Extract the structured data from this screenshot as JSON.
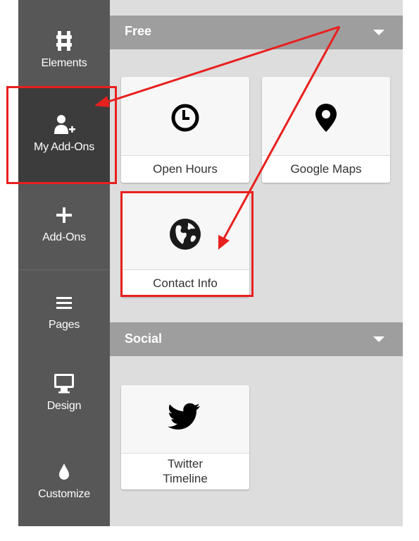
{
  "colors": {
    "sidebar_bg": "#575757",
    "sidebar_active_bg": "#3c3c3c",
    "panel_bg": "#dddddd",
    "section_header_bg": "#9e9e9e",
    "card_bg": "#f7f7f7",
    "annotation_red": "#e8201e"
  },
  "sidebar": {
    "items": [
      {
        "label": "Elements",
        "icon": "elements-icon",
        "active": false
      },
      {
        "label": "My Add-Ons",
        "icon": "user-plus-icon",
        "active": true
      },
      {
        "label": "Add-Ons",
        "icon": "plus-icon",
        "active": false
      },
      {
        "label": "Pages",
        "icon": "menu-icon",
        "active": false
      },
      {
        "label": "Design",
        "icon": "monitor-icon",
        "active": false
      },
      {
        "label": "Customize",
        "icon": "droplet-icon",
        "active": false
      }
    ]
  },
  "sections": [
    {
      "title": "Free",
      "icon": "chevron-down-icon",
      "cards": [
        {
          "label": "Open Hours",
          "icon": "clock-icon"
        },
        {
          "label": "Google Maps",
          "icon": "map-pin-icon"
        },
        {
          "label": "Contact Info",
          "icon": "globe-icon"
        }
      ]
    },
    {
      "title": "Social",
      "icon": "chevron-down-icon",
      "cards": [
        {
          "label_line1": "Twitter",
          "label_line2": "Timeline",
          "icon": "twitter-icon"
        }
      ]
    }
  ],
  "annotations": {
    "highlighted": [
      "My Add-Ons",
      "Contact Info"
    ],
    "arrow_color": "#e8201e"
  }
}
